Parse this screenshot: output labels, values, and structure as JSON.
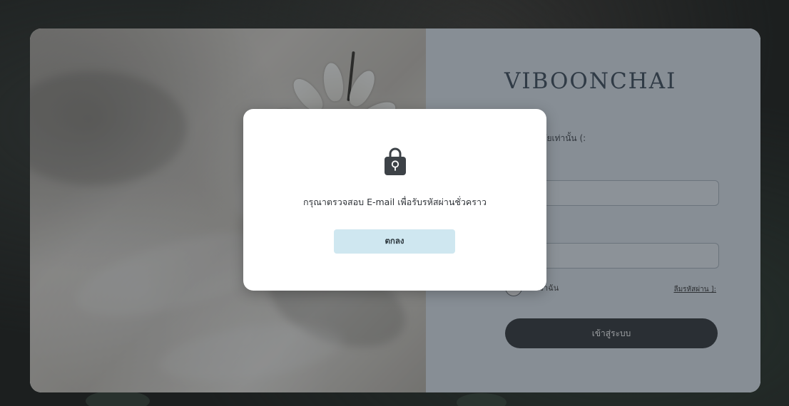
{
  "brand": {
    "name": "VIBOONCHAI"
  },
  "login": {
    "subtitle": "นร้านวิบูลชัยเท่านั้น (:",
    "remember_label": "จดจำฉัน",
    "forgot_label": "ลืมรหัสผ่าน ]:",
    "submit_label": "เข้าสู่ระบบ"
  },
  "modal": {
    "icon": "lock-icon",
    "message": "กรุณาตรวจสอบ E-mail เพื่อรับรหัสผ่านชั่วคราว",
    "ok_label": "ตกลง"
  },
  "colors": {
    "overlay": "rgba(40,46,52,0.48)",
    "login_button": "#2d3135",
    "modal_button": "#cfe7f0",
    "brand_text": "#394756"
  }
}
